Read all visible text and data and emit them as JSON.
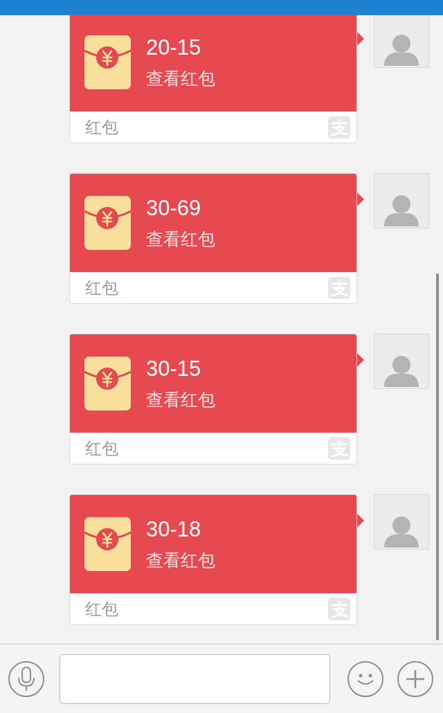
{
  "messages": [
    {
      "amount": "20-15",
      "action": "查看红包",
      "footer": "红包"
    },
    {
      "amount": "30-69",
      "action": "查看红包",
      "footer": "红包"
    },
    {
      "amount": "30-15",
      "action": "查看红包",
      "footer": "红包"
    },
    {
      "amount": "30-18",
      "action": "查看红包",
      "footer": "红包"
    }
  ]
}
